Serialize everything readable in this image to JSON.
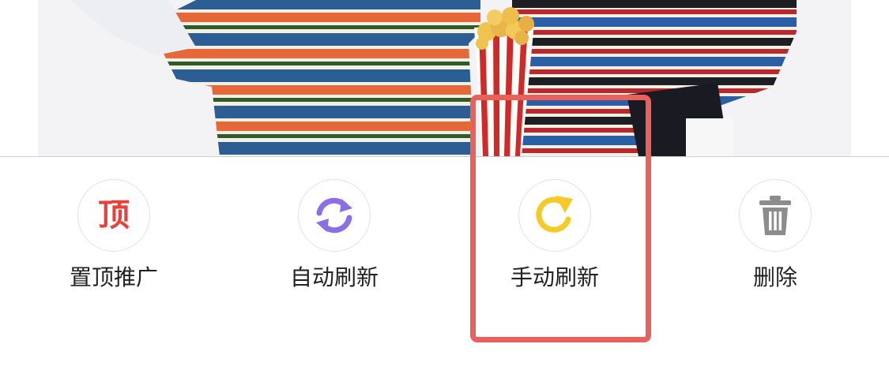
{
  "photo": {
    "description_icon": "product-photo"
  },
  "actions": [
    {
      "label": "置顶推广",
      "icon_text": "顶",
      "icon": "top-promote-icon",
      "color": "#e8413b"
    },
    {
      "label": "自动刷新",
      "icon": "auto-refresh-icon",
      "color": "#8a6fe6"
    },
    {
      "label": "手动刷新",
      "icon": "manual-refresh-icon",
      "color": "#f5c926"
    },
    {
      "label": "删除",
      "icon": "trash-icon",
      "color": "#8c8c8c"
    }
  ],
  "highlight": {
    "target": "手动刷新",
    "color": "#e8615a"
  }
}
